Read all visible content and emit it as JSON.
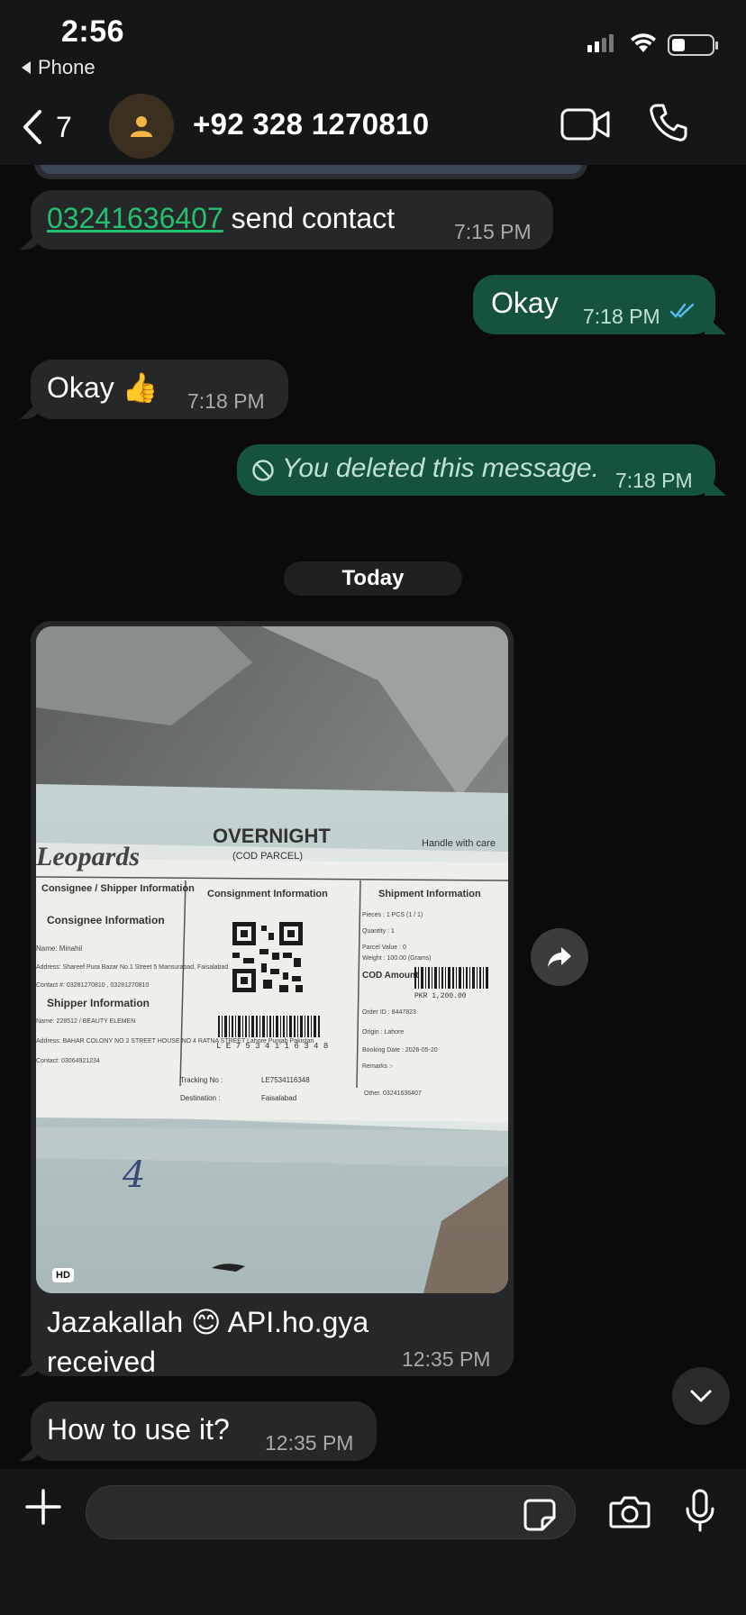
{
  "status_bar": {
    "time": "2:56",
    "back_app": "Phone"
  },
  "header": {
    "unread_count": "7",
    "contact_name": "+92 328 1270810"
  },
  "messages": [
    {
      "direction": "in",
      "link": "03241636407",
      "text": " send contact",
      "time": "7:15 PM"
    },
    {
      "direction": "out",
      "text": "Okay",
      "time": "7:18 PM",
      "status": "read"
    },
    {
      "direction": "in",
      "text": "Okay 👍",
      "time": "7:18 PM"
    },
    {
      "direction": "out",
      "text": "You deleted this message.",
      "time": "7:18 PM",
      "deleted": true
    },
    {
      "direction": "in",
      "type": "image",
      "hd_badge": "HD",
      "caption": "Jazakallah 😊 API.ho.gya received",
      "time": "12:35 PM"
    },
    {
      "direction": "in",
      "text": "How to use it?",
      "time": "12:35 PM"
    }
  ],
  "day_divider": "Today",
  "photo_label": {
    "brand": "Leopards",
    "service": "OVERNIGHT",
    "service_sub": "(COD PARCEL)",
    "handle": "Handle with care",
    "col1": "Consignee / Shipper Information",
    "col2": "Consignment Information",
    "col3": "Shipment Information",
    "consignee": "Consignee Information",
    "shipper": "Shipper Information",
    "name1": "Name: Minahil",
    "address1": "Address: Shareef Pura Bazar No.1 Street 5 Mansurabad, Faisalabad",
    "contact1": "Contact #: 03281270810 , 03281270810",
    "name2": "Name: 228512 / BEAUTY ELEMEN",
    "address2": "Address: BAHAR COLONY NO 2 STREET HOUSE NO 4 RATNA STREET Lahore Punjab Pakistan",
    "contact2": "Contact: 03064921234",
    "pieces": "Pieces : 1 PCS (1 / 1)",
    "quantity": "Quantity : 1",
    "parcel_value": "Parcel Value : 0",
    "weight": "Weight : 100.00 (Grams)",
    "cod_label": "COD Amount :",
    "cod_amount": "PKR 1,200.00",
    "order_id": "Order ID : 8447823",
    "origin": "Origin : Lahore",
    "booking_date": "Booking Date : 2026-05-20",
    "remarks": "Remarks :-",
    "other": "Other. 03241636407",
    "tracking_label": "Tracking No :",
    "tracking_no": "LE7534116348",
    "destination_label": "Destination :",
    "destination": "Faisalabad",
    "barcode_text": "L E 7 5 3 4 1 1 6 3 4 8",
    "handwritten": "4"
  },
  "input": {
    "placeholder": "",
    "value": ""
  },
  "colors": {
    "incoming_bubble": "#262729",
    "outgoing_bubble": "#155340",
    "link": "#25c06f",
    "read_ticks": "#53bdeb",
    "background": "#0b0b0c"
  },
  "icons": [
    "back-chevron-icon",
    "person-icon",
    "video-camera-icon",
    "phone-icon",
    "read-ticks-icon",
    "blocked-icon",
    "forward-icon",
    "chevron-down-icon",
    "plus-icon",
    "sticker-icon",
    "camera-icon",
    "microphone-icon"
  ]
}
